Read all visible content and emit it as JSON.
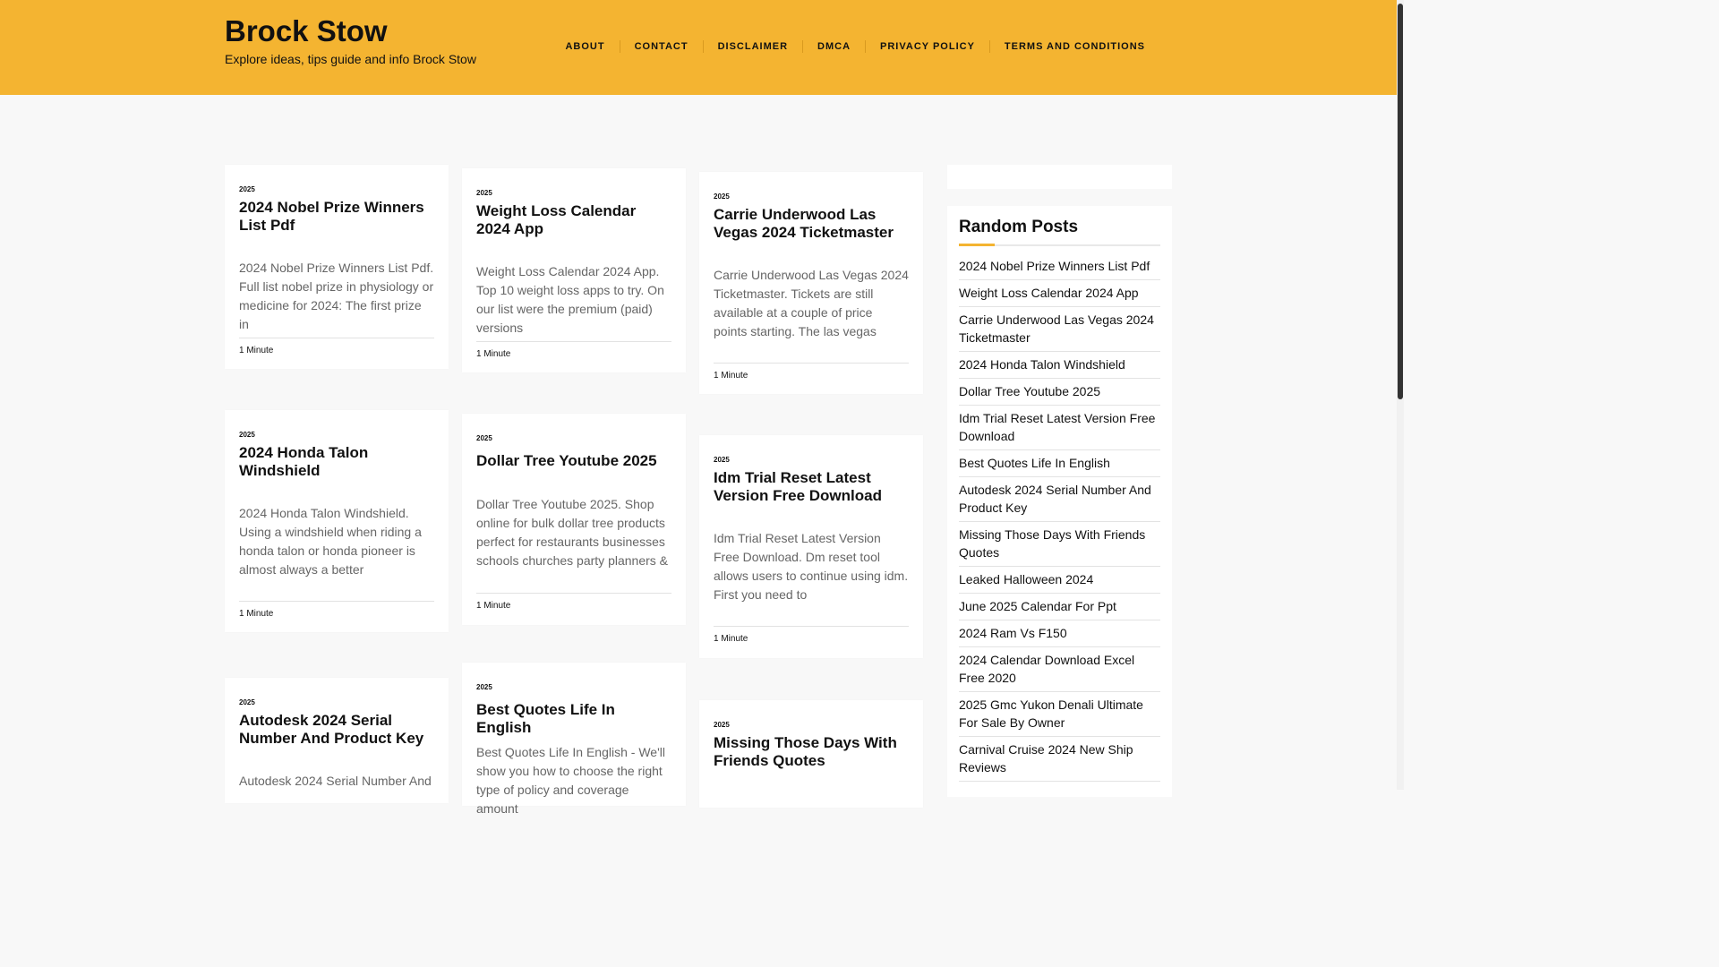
{
  "site": {
    "title": "Brock Stow",
    "description": "Explore ideas, tips guide and info Brock Stow"
  },
  "nav": [
    "ABOUT",
    "CONTACT",
    "DISCLAIMER",
    "DMCA",
    "PRIVACY POLICY",
    "TERMS AND CONDITIONS"
  ],
  "posts": [
    {
      "category": "2025",
      "title": "2024 Nobel Prize Winners List Pdf",
      "excerpt": "2024 Nobel Prize Winners List Pdf. Full list nobel prize in physiology or medicine for 2024: The first prize in",
      "meta": "1 Minute"
    },
    {
      "category": "2025",
      "title": "Weight Loss Calendar 2024 App",
      "excerpt": "Weight Loss Calendar 2024 App. Top 10 weight loss apps to try. On our list were the premium (paid) versions",
      "meta": "1 Minute"
    },
    {
      "category": "2025",
      "title": "Carrie Underwood Las Vegas 2024 Ticketmaster",
      "excerpt": "Carrie Underwood Las Vegas 2024 Ticketmaster. Tickets are still available at a couple of price points starting. The las vegas",
      "meta": "1 Minute"
    },
    {
      "category": "2025",
      "title": "2024 Honda Talon Windshield",
      "excerpt": "2024 Honda Talon Windshield. Using a windshield when riding a honda talon or honda pioneer is almost always a better",
      "meta": "1 Minute"
    },
    {
      "category": "2025",
      "title": "Dollar Tree Youtube 2025",
      "excerpt": "Dollar Tree Youtube 2025. Shop online for bulk dollar tree products perfect for restaurants businesses schools churches party planners &",
      "meta": "1 Minute"
    },
    {
      "category": "2025",
      "title": "Idm Trial Reset Latest Version Free Download",
      "excerpt": "Idm Trial Reset Latest Version Free Download. Dm reset tool allows users to continue using idm. First you need to",
      "meta": "1 Minute"
    },
    {
      "category": "2025",
      "title": "Autodesk 2024 Serial Number And Product Key",
      "excerpt": "Autodesk 2024 Serial Number And",
      "meta": ""
    },
    {
      "category": "2025",
      "title": "Best Quotes Life In English",
      "excerpt": "Best Quotes Life In English - We'll show you how to choose the right type of policy and coverage amount",
      "meta": ""
    },
    {
      "category": "2025",
      "title": "Missing Those Days With Friends Quotes",
      "excerpt": "",
      "meta": ""
    }
  ],
  "sidebar": {
    "widget_title": "Random Posts",
    "items": [
      "2024 Nobel Prize Winners List Pdf",
      "Weight Loss Calendar 2024 App",
      "Carrie Underwood Las Vegas 2024 Ticketmaster",
      "2024 Honda Talon Windshield",
      "Dollar Tree Youtube 2025",
      "Idm Trial Reset Latest Version Free Download",
      "Best Quotes Life In English",
      "Autodesk 2024 Serial Number And Product Key",
      "Missing Those Days With Friends Quotes",
      "Leaked Halloween 2024",
      "June 2025 Calendar For Ppt",
      "2024 Ram Vs F150",
      "2024 Calendar Download Excel Free 2020",
      "2025 Gmc Yukon Denali Ultimate For Sale By Owner",
      "Carnival Cruise 2024 New Ship Reviews"
    ]
  },
  "colors": {
    "header_bg": "#f4b431",
    "accent": "#f4b431"
  }
}
